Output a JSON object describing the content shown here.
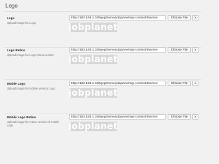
{
  "section": {
    "title": "Logo"
  },
  "fields": [
    {
      "label": "Logo",
      "description": "Upload image for Logo",
      "value": "http://192.168.1.169/jegtheme/jobplanet/wp-content/themes",
      "choose_label": "Choose File",
      "remove_label": "x",
      "preview_text": "jobplanet"
    },
    {
      "label": "Logo Retina",
      "description": "Upload image for Logo retina version",
      "value": "http://192.168.1.169/jegtheme/jobplanet/wp-content/themes",
      "choose_label": "Choose File",
      "remove_label": "x",
      "preview_text": "jobplanet"
    },
    {
      "label": "Mobile Logo",
      "description": "Upload image for mobile version Logo",
      "value": "http://192.168.1.169/jegtheme/jobplanet/wp-content/themes",
      "choose_label": "Choose File",
      "remove_label": "x",
      "preview_text": "jobplanet"
    },
    {
      "label": "Mobile Logo Retina",
      "description": "Upload image for retina version of mobile Logo",
      "value": "http://192.168.1.169/jegtheme/jobplanet/wp-content/themes",
      "choose_label": "Choose File",
      "remove_label": "x",
      "preview_text": "jobplanet"
    }
  ]
}
